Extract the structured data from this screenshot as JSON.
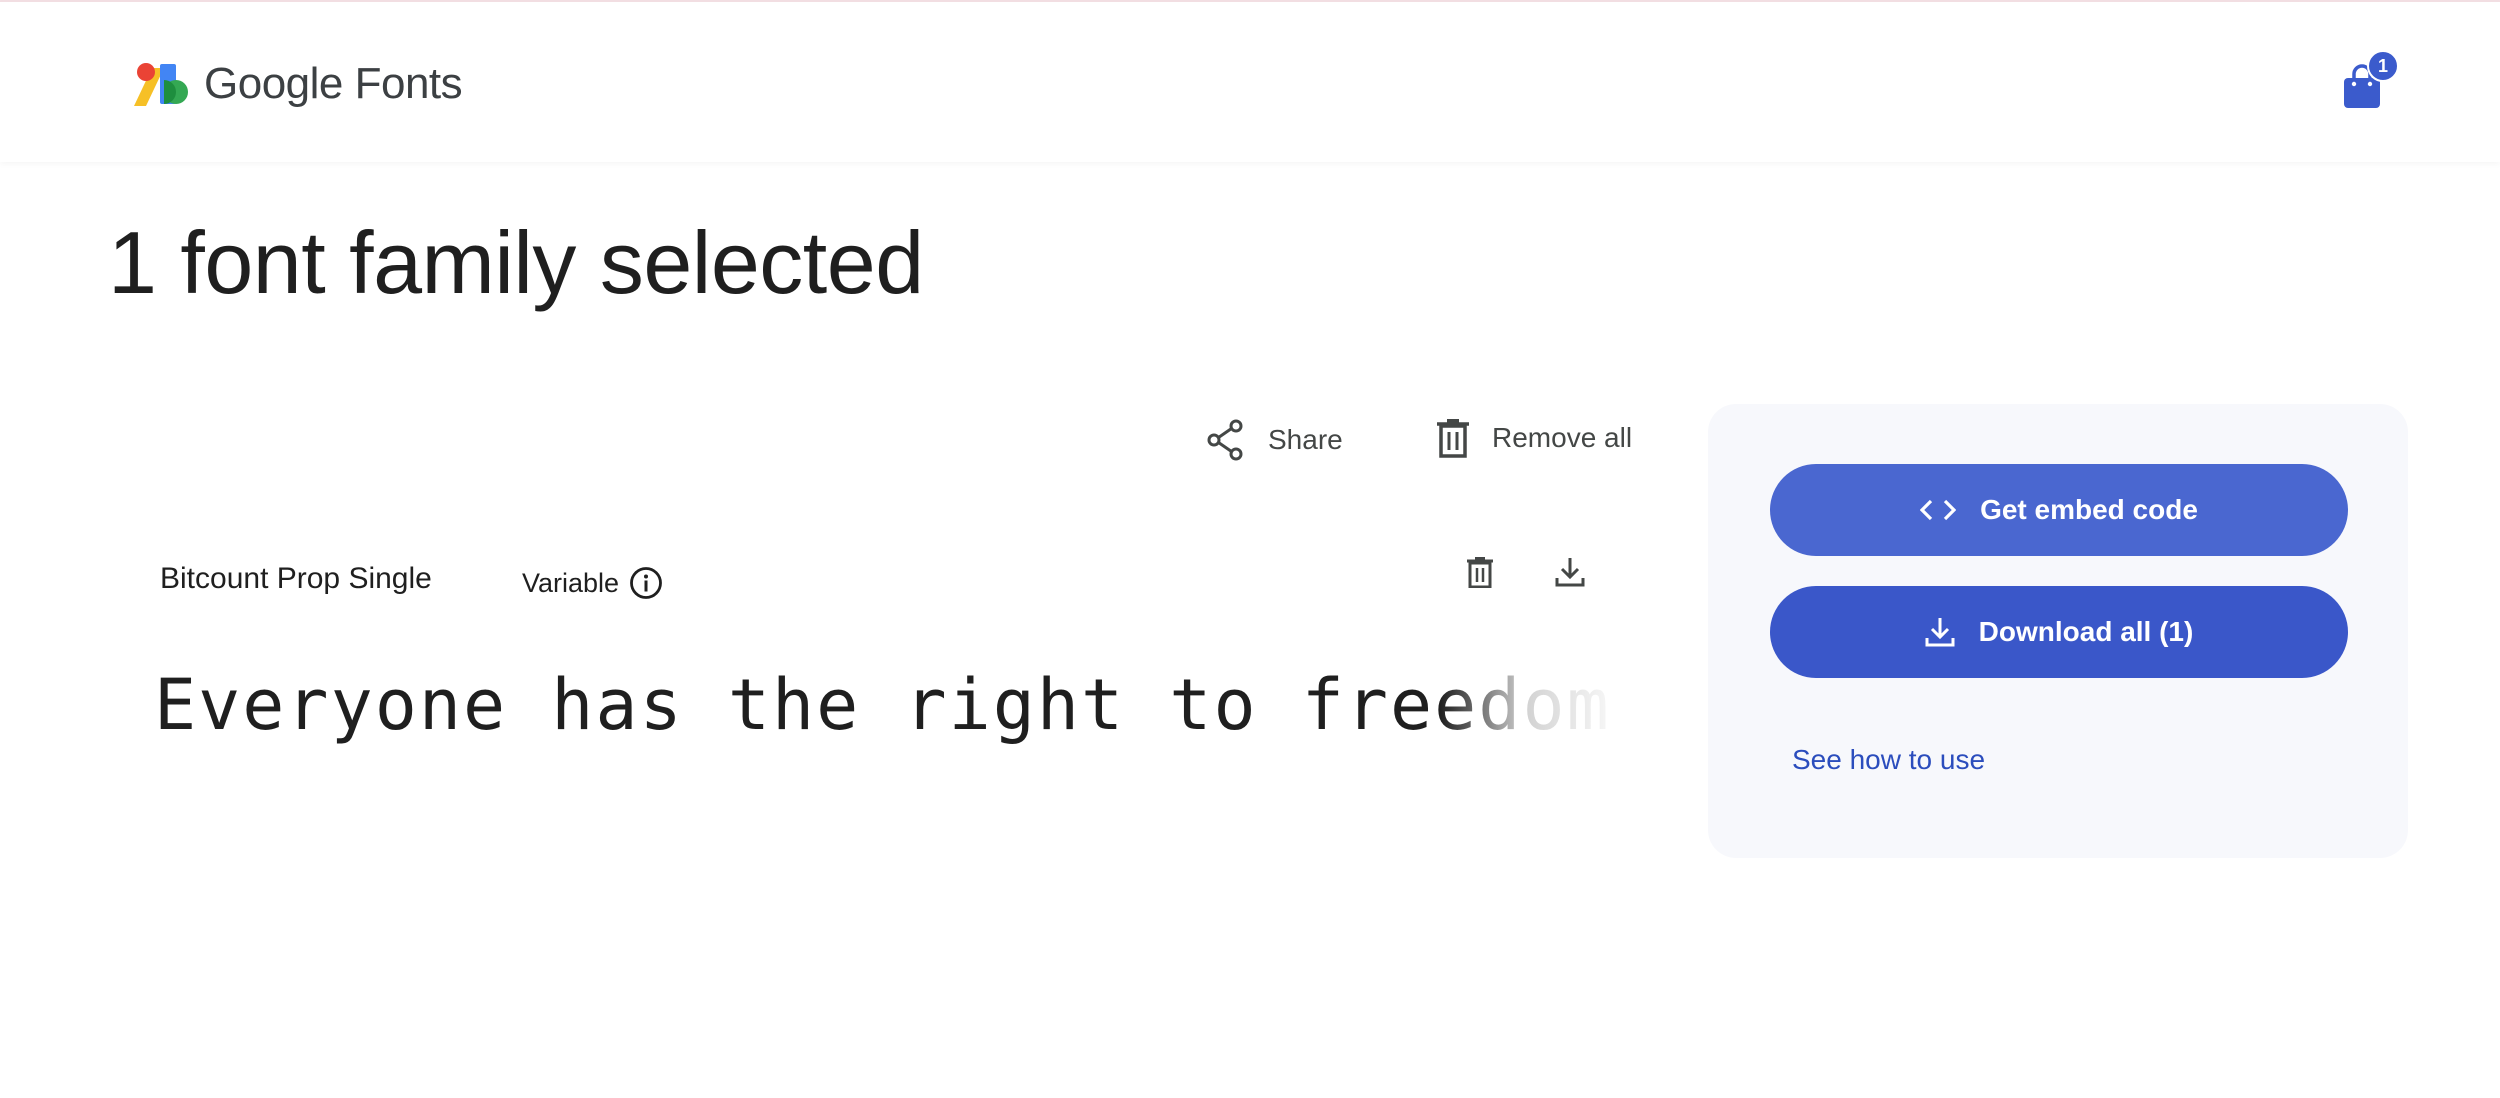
{
  "header": {
    "logo_text": "Google Fonts",
    "cart_count": "1"
  },
  "page_title": "1 font family selected",
  "actions": {
    "share_label": "Share",
    "remove_all_label": "Remove all"
  },
  "font_card": {
    "name": "Bitcount Prop Single",
    "type_label": "Variable",
    "preview_text": "Everyone has the right to freedom of t"
  },
  "side_panel": {
    "embed_label": "Get embed code",
    "download_label": "Download all (1)",
    "how_to_label": "See how to use"
  },
  "colors": {
    "accent": "#3b5bcc",
    "panel_bg": "#f7f8fc",
    "link": "#2b4dbd"
  },
  "icons": [
    "google-fonts-logo",
    "shopping-bag-icon",
    "share-icon",
    "trash-icon",
    "info-icon",
    "download-icon",
    "code-icon"
  ]
}
